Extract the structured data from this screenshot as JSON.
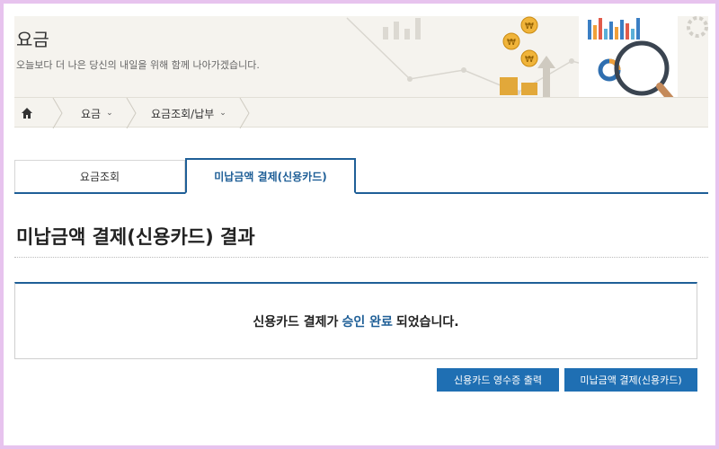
{
  "banner": {
    "title": "요금",
    "subtitle": "오늘보다 더 나은 당신의 내일을 위해 함께 나아가겠습니다."
  },
  "breadcrumb": {
    "home_icon": "home-icon",
    "items": [
      {
        "label": "요금"
      },
      {
        "label": "요금조회/납부"
      }
    ]
  },
  "tabs": [
    {
      "label": "요금조회",
      "active": false
    },
    {
      "label": "미납금액 결제(신용카드)",
      "active": true
    }
  ],
  "page_title": "미납금액 결제(신용카드) 결과",
  "result": {
    "prefix": "신용카드 결제가",
    "highlight": "승인 완료",
    "suffix": "되었습니다."
  },
  "buttons": {
    "receipt": "신용카드 영수증 출력",
    "pay": "미납금액 결제(신용카드)"
  },
  "colors": {
    "accent": "#1f5f97",
    "button": "#1f6fb3",
    "frame": "#e7c3ee"
  }
}
